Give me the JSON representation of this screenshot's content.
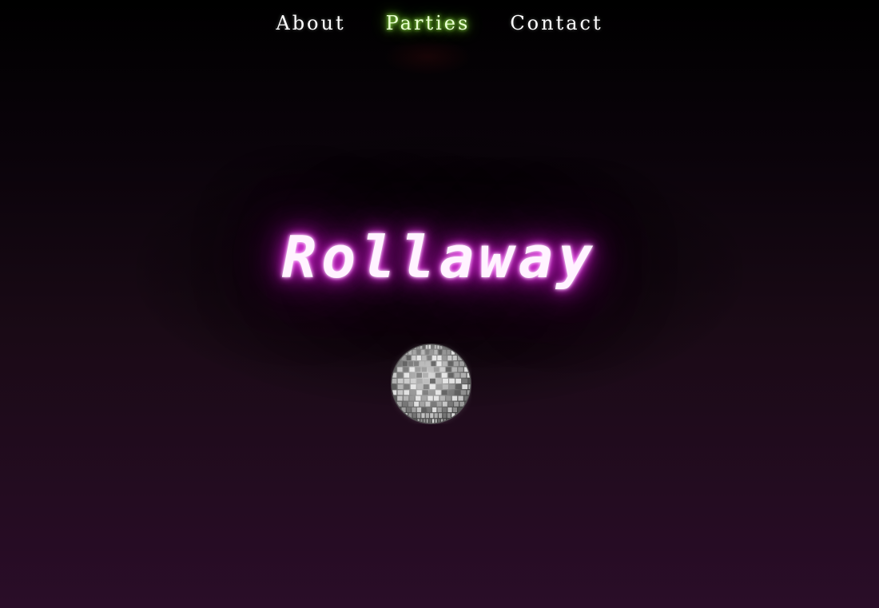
{
  "nav": {
    "items": [
      {
        "label": "About",
        "active": false
      },
      {
        "label": "Parties",
        "active": true
      },
      {
        "label": "Contact",
        "active": false
      }
    ]
  },
  "hero": {
    "title": "Rollaway",
    "icon": "disco-ball-icon"
  },
  "colors": {
    "background_top": "#000000",
    "background_bottom": "#2a0d28",
    "title_glow": "#dd22dd",
    "active_nav_glow": "#88ee33"
  }
}
